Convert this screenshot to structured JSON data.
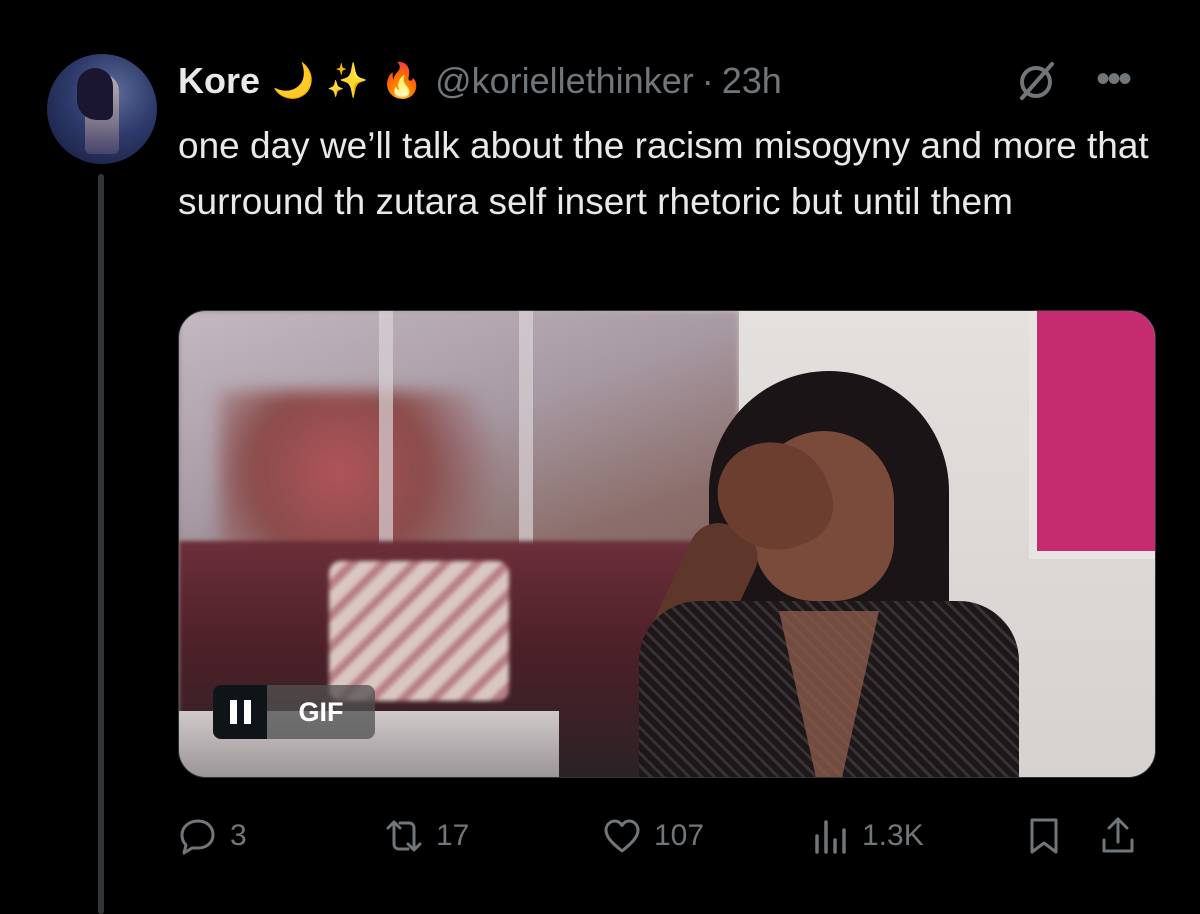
{
  "author": {
    "name": "Kore",
    "emojis": [
      "🌙",
      "✨",
      "🔥"
    ],
    "handle": "@korielle thinker",
    "handle_display": "@korielle​thinker",
    "separator": "·",
    "time": "23h"
  },
  "tweet": {
    "text": "one day we’ll talk about the racism misogyny and more that surround th zutara self insert rhetoric but until them"
  },
  "media": {
    "type": "gif",
    "badge_label": "GIF",
    "pause_icon": "pause-icon"
  },
  "actions": {
    "replies": "3",
    "reposts": "17",
    "likes": "107",
    "views": "1.3K"
  },
  "icons": {
    "reply": "reply-icon",
    "repost": "repost-icon",
    "like": "heart-icon",
    "views": "views-icon",
    "bookmark": "bookmark-icon",
    "share": "share-icon",
    "grok": "grok-icon",
    "more": "more-icon"
  },
  "colors": {
    "background": "#000000",
    "text": "#e7e9ea",
    "muted": "#71767b",
    "thread_line": "#333639"
  }
}
